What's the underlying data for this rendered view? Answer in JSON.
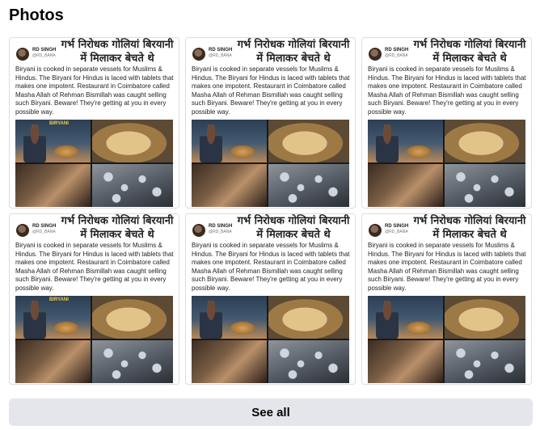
{
  "section": {
    "title": "Photos"
  },
  "post": {
    "headline_hindi": "गर्भ निरोधक गोलियां बिरयानी में मिलाकर बेचते थे",
    "user_name": "RD SINGH",
    "user_handle": "@RD_BANA",
    "body": "Biryani is cooked in separate vessels for Muslims & Hindus. The Biryani for Hindus is laced with tablets that makes one impotent. Restaurant in Coimbatore called Masha Allah of Rehman Bismillah was caught selling such Biryani. Beware! They're getting at you in every possible way.",
    "collage_label": "BIRYANI"
  },
  "photos": [
    {
      "id": 1
    },
    {
      "id": 2
    },
    {
      "id": 3
    },
    {
      "id": 4
    },
    {
      "id": 5
    },
    {
      "id": 6
    }
  ],
  "footer": {
    "see_all_label": "See all"
  }
}
